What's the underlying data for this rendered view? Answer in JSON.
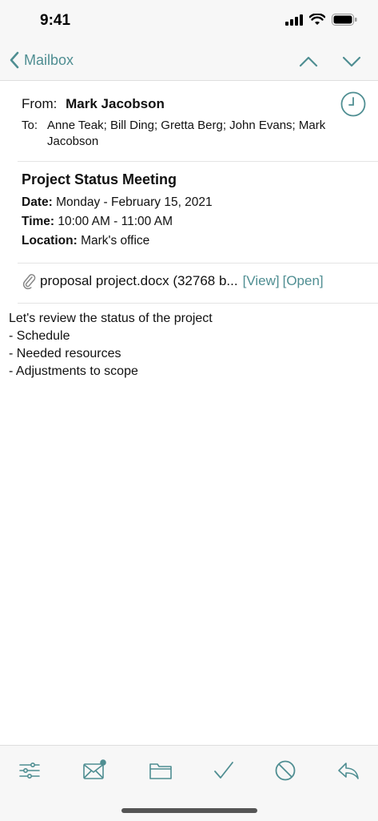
{
  "status": {
    "time": "9:41"
  },
  "nav": {
    "back_label": "Mailbox"
  },
  "header": {
    "from_label": "From:",
    "from_name": "Mark Jacobson",
    "to_label": "To:",
    "to_value": "Anne Teak; Bill Ding; Gretta Berg; John Evans; Mark Jacobson"
  },
  "meeting": {
    "title": "Project Status Meeting",
    "date_label": "Date:",
    "date_value": "Monday - February 15, 2021",
    "time_label": "Time:",
    "time_value": "10:00 AM - 11:00 AM",
    "location_label": "Location:",
    "location_value": "Mark's office"
  },
  "attachment": {
    "name": "proposal project.docx (32768 b...",
    "view_label": "[View]",
    "open_label": "[Open]"
  },
  "body": {
    "lines": [
      "Let's review the status of the project",
      "- Schedule",
      "- Needed resources",
      "- Adjustments to scope"
    ]
  },
  "toolbar": {
    "icons": [
      "filter-icon",
      "mail-unread-icon",
      "folder-icon",
      "checkmark-icon",
      "block-icon",
      "reply-icon"
    ]
  },
  "colors": {
    "accent": "#4f8e92",
    "bar_bg": "#f7f7f7"
  }
}
